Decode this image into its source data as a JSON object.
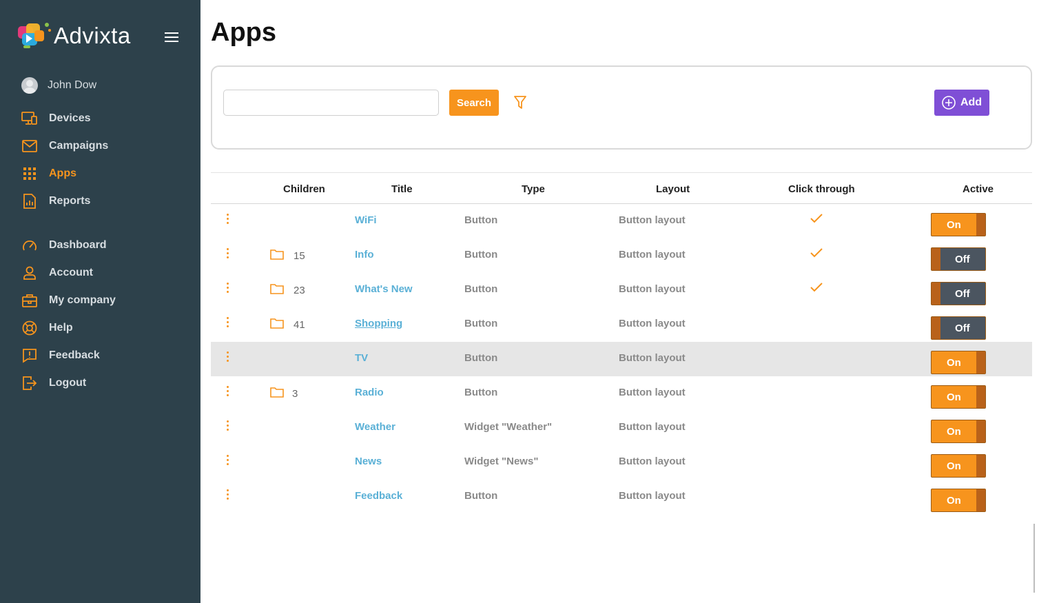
{
  "brand": {
    "name": "Advixta"
  },
  "user": {
    "name": "John Dow"
  },
  "nav": {
    "items": [
      {
        "label": "Devices",
        "icon": "monitor-icon"
      },
      {
        "label": "Campaigns",
        "icon": "envelope-icon"
      },
      {
        "label": "Apps",
        "icon": "grid-icon",
        "active": true
      },
      {
        "label": "Reports",
        "icon": "report-icon"
      },
      {
        "label": "Dashboard",
        "icon": "gauge-icon"
      },
      {
        "label": "Account",
        "icon": "user-icon"
      },
      {
        "label": "My company",
        "icon": "briefcase-icon"
      },
      {
        "label": "Help",
        "icon": "lifebuoy-icon"
      },
      {
        "label": "Feedback",
        "icon": "feedback-icon"
      },
      {
        "label": "Logout",
        "icon": "logout-icon"
      }
    ]
  },
  "page": {
    "title": "Apps"
  },
  "toolbar": {
    "search_value": "",
    "search_label": "Search",
    "add_label": "Add"
  },
  "table": {
    "headers": {
      "children": "Children",
      "title": "Title",
      "type": "Type",
      "layout": "Layout",
      "click_through": "Click through",
      "active": "Active"
    },
    "rows": [
      {
        "children": "",
        "title": "WiFi",
        "type": "Button",
        "layout": "Button layout",
        "click_through": true,
        "active": "On"
      },
      {
        "children": "15",
        "title": "Info",
        "type": "Button",
        "layout": "Button layout",
        "click_through": true,
        "active": "Off"
      },
      {
        "children": "23",
        "title": "What's New",
        "type": "Button",
        "layout": "Button layout",
        "click_through": true,
        "active": "Off"
      },
      {
        "children": "41",
        "title": "Shopping",
        "type": "Button",
        "layout": "Button layout",
        "click_through": false,
        "active": "Off",
        "hovered": true
      },
      {
        "children": "",
        "title": "TV",
        "type": "Button",
        "layout": "Button layout",
        "click_through": false,
        "active": "On",
        "highlighted": true
      },
      {
        "children": "3",
        "title": "Radio",
        "type": "Button",
        "layout": "Button layout",
        "click_through": false,
        "active": "On"
      },
      {
        "children": "",
        "title": "Weather",
        "type": "Widget \"Weather\"",
        "layout": "Button layout",
        "click_through": false,
        "active": "On"
      },
      {
        "children": "",
        "title": "News",
        "type": "Widget \"News\"",
        "layout": "Button layout",
        "click_through": false,
        "active": "On"
      },
      {
        "children": "",
        "title": "Feedback",
        "type": "Button",
        "layout": "Button layout",
        "click_through": false,
        "active": "On"
      }
    ]
  },
  "colors": {
    "sidebar": "#2d414b",
    "accent": "#f7941d",
    "link": "#5ab0d6",
    "add_button": "#7f4fd6",
    "toggle_off": "#4b5560"
  }
}
